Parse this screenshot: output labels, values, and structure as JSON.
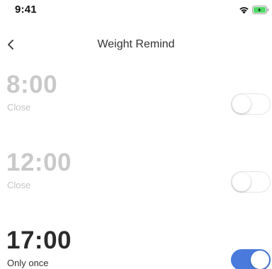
{
  "status_bar": {
    "time": "9:41",
    "icons": [
      "wifi-icon",
      "battery-charging-icon"
    ],
    "battery_color": "#4cd964"
  },
  "nav": {
    "title": "Weight Remind",
    "back_icon": "chevron-left-icon"
  },
  "alarms": [
    {
      "time": "8:00",
      "status": "Close",
      "enabled": false
    },
    {
      "time": "12:00",
      "status": "Close",
      "enabled": false
    },
    {
      "time": "17:00",
      "status": "Only once",
      "enabled": true
    }
  ],
  "colors": {
    "toggle_on": "#4a7bdc",
    "time_disabled": "#c9c9c9",
    "time_enabled": "#2b2b2b"
  }
}
